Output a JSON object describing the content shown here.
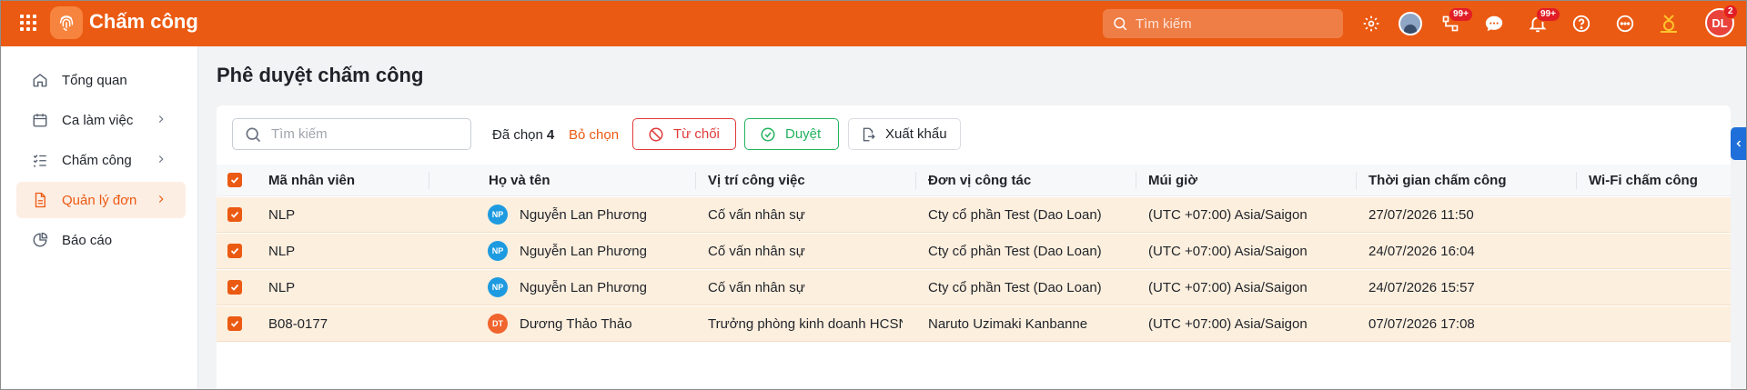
{
  "app": {
    "title": "Chấm công",
    "brand_color": "#eb5a12"
  },
  "topbar": {
    "search_placeholder": "Tìm kiếm",
    "icons": [
      "grid-icon",
      "fingerprint-icon",
      "search-icon",
      "gear-icon",
      "avatar-icon",
      "flow-icon",
      "chat-icon",
      "bell-icon",
      "help-icon",
      "more-icon",
      "medal-icon"
    ],
    "flow_badge": "99+",
    "bell_badge": "99+",
    "user_initials": "DL",
    "user_badge": "2"
  },
  "sidebar": {
    "items": [
      {
        "label": "Tổng quan",
        "icon": "home-icon",
        "has_chevron": false,
        "active": false
      },
      {
        "label": "Ca làm việc",
        "icon": "calendar-icon",
        "has_chevron": true,
        "active": false
      },
      {
        "label": "Chấm công",
        "icon": "checklist-icon",
        "has_chevron": true,
        "active": false
      },
      {
        "label": "Quản lý đơn",
        "icon": "document-icon",
        "has_chevron": true,
        "active": true
      },
      {
        "label": "Báo cáo",
        "icon": "pie-chart-icon",
        "has_chevron": false,
        "active": false
      }
    ]
  },
  "page": {
    "title": "Phê duyệt chấm công"
  },
  "toolbar": {
    "search_placeholder": "Tìm kiếm",
    "selected_label": "Đã chọn",
    "selected_count": "4",
    "deselect_label": "Bỏ chọn",
    "reject_label": "Từ chối",
    "approve_label": "Duyệt",
    "export_label": "Xuất khẩu"
  },
  "table": {
    "columns": [
      "Mã nhân viên",
      "Họ và tên",
      "Vị trí công việc",
      "Đơn vị công tác",
      "Múi giờ",
      "Thời gian chấm công",
      "Wi-Fi chấm công"
    ],
    "rows": [
      {
        "code": "NLP",
        "initials": "NP",
        "avatar_color": "#1e9be0",
        "name": "Nguyễn Lan Phương",
        "position": "Cố vấn nhân sự",
        "unit": "Cty cổ phần Test (Dao Loan)",
        "timezone": "(UTC +07:00) Asia/Saigon",
        "time": "27/07/2026 11:50",
        "wifi": ""
      },
      {
        "code": "NLP",
        "initials": "NP",
        "avatar_color": "#1e9be0",
        "name": "Nguyễn Lan Phương",
        "position": "Cố vấn nhân sự",
        "unit": "Cty cổ phần Test (Dao Loan)",
        "timezone": "(UTC +07:00) Asia/Saigon",
        "time": "24/07/2026 16:04",
        "wifi": ""
      },
      {
        "code": "NLP",
        "initials": "NP",
        "avatar_color": "#1e9be0",
        "name": "Nguyễn Lan Phương",
        "position": "Cố vấn nhân sự",
        "unit": "Cty cổ phần Test (Dao Loan)",
        "timezone": "(UTC +07:00) Asia/Saigon",
        "time": "24/07/2026 15:57",
        "wifi": ""
      },
      {
        "code": "B08-0177",
        "initials": "DT",
        "avatar_color": "#f0642d",
        "name": "Dương Thảo Thảo",
        "position": "Trưởng phòng kinh doanh HCSN",
        "unit": "Naruto Uzimaki Kanbanne",
        "timezone": "(UTC +07:00) Asia/Saigon",
        "time": "07/07/2026 17:08",
        "wifi": ""
      }
    ]
  }
}
